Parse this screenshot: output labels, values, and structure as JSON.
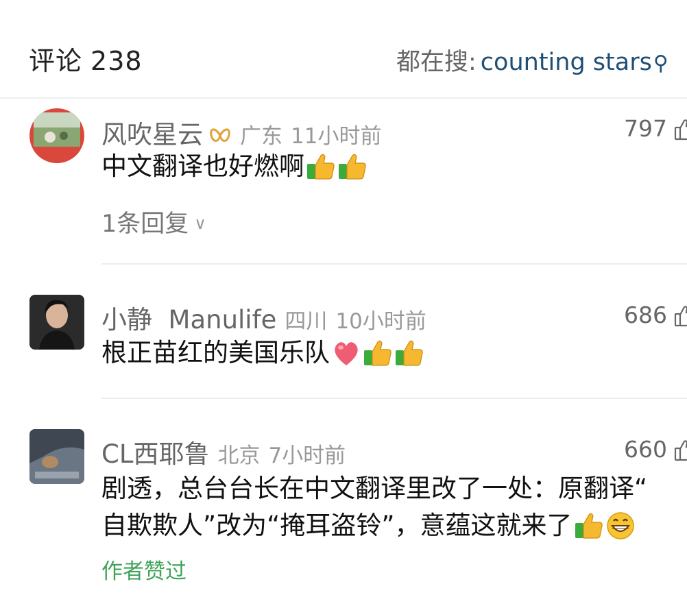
{
  "header": {
    "title": "评论",
    "count": "238",
    "hot_search_label": "都在搜:",
    "hot_search_term": "counting stars",
    "search_icon": "search-icon"
  },
  "comments": [
    {
      "username": "风吹星云",
      "badge_icon": "gold-ribbon-badge-icon",
      "location": "广东",
      "time": "11小时前",
      "likes": "797",
      "text": "中文翻译也好燃啊",
      "emojis": [
        "thumbs-up",
        "thumbs-up"
      ],
      "reply_label": "1条回复"
    },
    {
      "username": "小静  Manulife",
      "location": "四川",
      "time": "10小时前",
      "likes": "686",
      "text": "根正苗红的美国乐队",
      "emojis": [
        "heart",
        "thumbs-up",
        "thumbs-up"
      ]
    },
    {
      "username": "CL西耶鲁",
      "location": "北京",
      "time": "7小时前",
      "likes": "660",
      "text_line1": "剧透，总台台长在中文翻译里改了一处：原翻译“",
      "text_line2": "自欺欺人”改为“掩耳盗铃”，意蕴这就来了",
      "emojis": [
        "thumbs-up",
        "grin"
      ],
      "author_liked": "作者赞过"
    }
  ],
  "colors": {
    "link": "#1f4f74",
    "author_liked": "#3fa35a",
    "meta": "#999999"
  }
}
